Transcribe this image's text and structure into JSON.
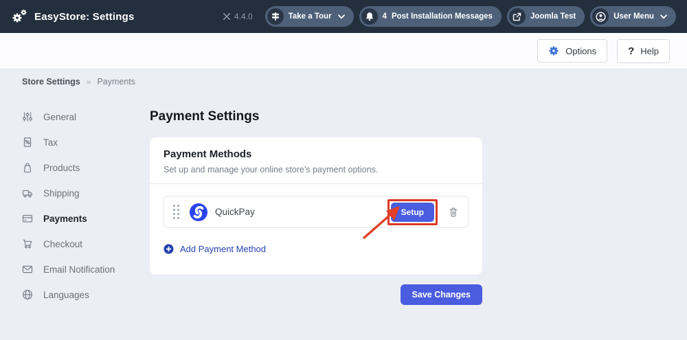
{
  "navbar": {
    "title": "EasyStore: Settings",
    "logo_icon": "cogs-icon",
    "version": "4.4.0",
    "version_icon": "joomla-icon",
    "pills": {
      "tour": {
        "label": "Take a Tour",
        "icon": "signpost-icon"
      },
      "messages": {
        "label": "Post Installation Messages",
        "count": "4",
        "icon": "bell-icon"
      },
      "site": {
        "label": "Joomla Test",
        "icon": "external-link-icon"
      },
      "user": {
        "label": "User Menu",
        "icon": "user-icon"
      }
    }
  },
  "toolbar": {
    "options_label": "Options",
    "options_icon": "gear-icon",
    "help_label": "Help",
    "help_icon": "question-icon"
  },
  "breadcrumb": {
    "root": "Store Settings",
    "separator": "»",
    "current": "Payments"
  },
  "sidebar": {
    "items": [
      {
        "label": "General",
        "icon": "sliders-icon",
        "active": false
      },
      {
        "label": "Tax",
        "icon": "tax-document-icon",
        "active": false
      },
      {
        "label": "Products",
        "icon": "shopping-bag-icon",
        "active": false
      },
      {
        "label": "Shipping",
        "icon": "truck-icon",
        "active": false
      },
      {
        "label": "Payments",
        "icon": "credit-card-icon",
        "active": true
      },
      {
        "label": "Checkout",
        "icon": "cart-icon",
        "active": false
      },
      {
        "label": "Email Notification",
        "icon": "envelope-icon",
        "active": false
      },
      {
        "label": "Languages",
        "icon": "globe-icon",
        "active": false
      }
    ]
  },
  "main": {
    "title": "Payment Settings",
    "card": {
      "title": "Payment Methods",
      "subtitle": "Set up and manage your online store's payment options.",
      "methods": [
        {
          "name": "QuickPay",
          "logo": "quickpay-logo",
          "setup_label": "Setup"
        }
      ],
      "add_link": "Add Payment Method"
    },
    "save_button": "Save Changes"
  },
  "annotation": {
    "type": "red box and arrow",
    "target": "setup-button",
    "color": "#d93a25"
  },
  "colors": {
    "navbar_bg": "#242f3e",
    "pill_bg": "#4e6179",
    "accent_blue": "#4a5cdf",
    "quickpay_blue": "#2b43ef",
    "link_blue": "#2442ae",
    "annotation_red": "#d93a25",
    "content_bg": "#eceef6"
  }
}
